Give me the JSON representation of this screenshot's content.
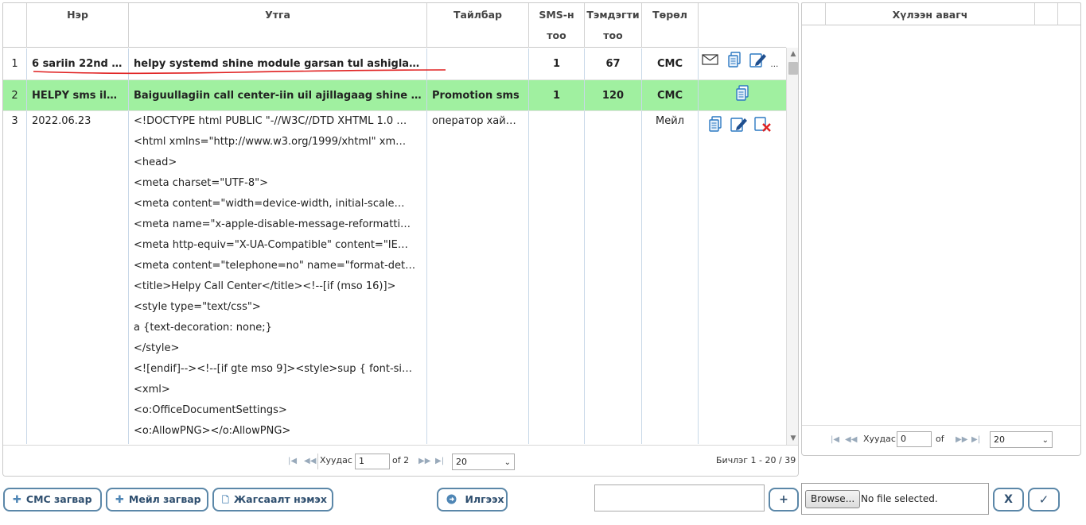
{
  "grid": {
    "columns": [
      "Нэр",
      "Утга",
      "Тайлбар",
      "SMS-н тоо",
      "Тэмдэгти тоо",
      "Төрөл"
    ],
    "col_sms_line1": "SMS-н",
    "col_sms_line2": "тоо",
    "col_chars_line1": "Тэмдэгти",
    "col_chars_line2": "тоо",
    "rows": [
      {
        "index": "1",
        "name": "6 sariin 22nd y…",
        "value": "helpy systemd shine module garsan tul ashiglaad …",
        "description": "",
        "sms_count": "1",
        "char_count": "67",
        "type": "СМС",
        "actions": [
          "mail-icon",
          "copy-icon",
          "edit-icon"
        ]
      },
      {
        "index": "2",
        "name": "HELPY sms ilg…",
        "value": "Baiguullagiin call center-iin uil ajillagaag shine tuv…",
        "description": "Promotion sms",
        "sms_count": "1",
        "char_count": "120",
        "type": "СМС",
        "actions": [
          "copy-icon"
        ]
      },
      {
        "index": "3",
        "name": "2022.06.23",
        "value_lines": [
          "<!DOCTYPE html PUBLIC \"-//W3C//DTD XHTML 1.0 …",
          "<html xmlns=\"http://www.w3.org/1999/xhtml\" xm…",
          " <head>",
          "  <meta charset=\"UTF-8\">",
          "  <meta content=\"width=device-width, initial-scale…",
          "  <meta name=\"x-apple-disable-message-reformatti…",
          "  <meta http-equiv=\"X-UA-Compatible\" content=\"IE…",
          "  <meta content=\"telephone=no\" name=\"format-det…",
          "  <title>Helpy Call Center</title><!--[if (mso 16)]>",
          "    <style type=\"text/css\">",
          "    a {text-decoration: none;}",
          "    </style>",
          "    <![endif]--><!--[if gte mso 9]><style>sup { font-si…",
          "<xml>",
          "    <o:OfficeDocumentSettings>",
          "    <o:AllowPNG></o:AllowPNG>"
        ],
        "description": "оператор хайж…",
        "sms_count": "",
        "char_count": "",
        "type": "Мейл",
        "actions": [
          "copy-icon",
          "edit-icon",
          "delete-icon"
        ]
      }
    ],
    "pager": {
      "page_label": "Хуудас",
      "page_value": "1",
      "of_label": "of 2",
      "page_size": "20",
      "records": "Бичлэг 1 - 20 / 39"
    }
  },
  "side": {
    "title": "Хүлээн авагч",
    "pager": {
      "page_label": "Хуудас",
      "page_value": "0",
      "of_label": "of",
      "page_size": "20"
    }
  },
  "toolbar": {
    "sms_template_label": "СМС загвар",
    "mail_template_label": "Мейл загвар",
    "add_list_label": "Жагсаалт нэмэх",
    "send_label": "Илгээх",
    "plus_label": "+",
    "browse_label": "Browse...",
    "file_status": "No file selected.",
    "clear_label": "X",
    "confirm_label": "✓"
  },
  "colors": {
    "highlight_row": "#a0f0a0",
    "button_border": "#5b87a8",
    "underline_red": "#e02020"
  }
}
